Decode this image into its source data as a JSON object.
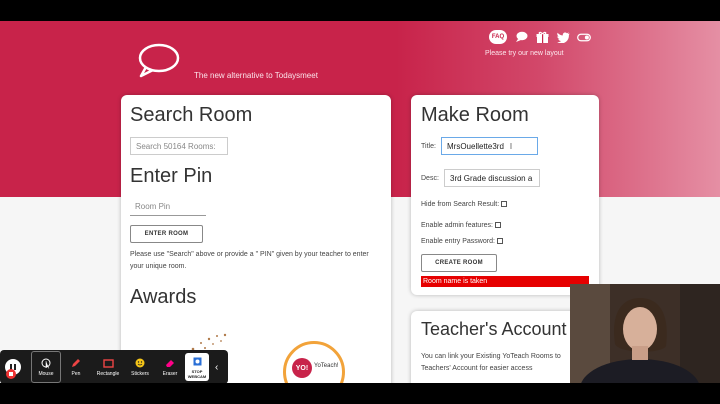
{
  "header": {
    "tagline": "The new alternative to Todaysmeet",
    "faq": "FAQ",
    "new_layout": "Please try our new layout",
    "icons": [
      "chat-icon",
      "gift-icon",
      "twitter-icon",
      "toggle-icon"
    ]
  },
  "search_card": {
    "title": "Search Room",
    "search_placeholder": "Search 50164 Rooms:",
    "pin_title": "Enter Pin",
    "pin_placeholder": "Room Pin",
    "enter_button": "ENTER ROOM",
    "help": "Please use \"Search\" above or provide a \" PIN\" given by your teacher to enter your unique room.",
    "awards_title": "Awards",
    "badge_yo": "YO!",
    "badge_text": "YoTeach!"
  },
  "make_card": {
    "title": "Make Room",
    "title_label": "Title:",
    "title_value": "MrsOuellette3rd",
    "desc_label": "Desc:",
    "desc_value": "3rd Grade discussion a",
    "hide_label": "Hide from Search Result:",
    "admin_label": "Enable admin features:",
    "password_label": "Enable entry Password:",
    "create_button": "CREATE ROOM",
    "error": "Room name is taken"
  },
  "teacher_card": {
    "title": "Teacher's Account",
    "text": "You can link your Existing YoTeach Rooms to Teachers' Account for easier access"
  },
  "toolbar": {
    "tools": [
      {
        "label": "Mouse",
        "icon": "cursor-icon"
      },
      {
        "label": "Pen",
        "icon": "pen-icon"
      },
      {
        "label": "Rectangle",
        "icon": "rectangle-icon"
      },
      {
        "label": "Stickers",
        "icon": "sticker-icon"
      },
      {
        "label": "Eraser",
        "icon": "eraser-icon"
      },
      {
        "label": "STOP WEBCAM",
        "icon": "webcam-icon"
      }
    ]
  }
}
